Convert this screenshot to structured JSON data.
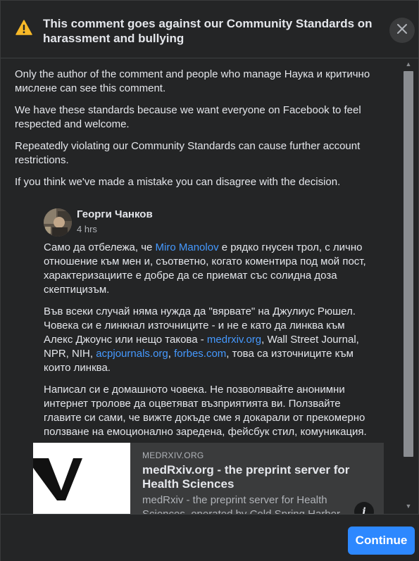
{
  "header": {
    "title": "This comment goes against our Community Standards on harassment and bullying",
    "warning_icon": "warning-triangle-icon",
    "close_icon": "close-icon"
  },
  "body": {
    "paragraphs": [
      "Only the author of the comment and people who manage Наука и критично мислене can see this comment.",
      "We have these standards because we want everyone on Facebook to feel respected and welcome.",
      "Repeatedly violating our Community Standards can cause further account restrictions.",
      "If you think we've made a mistake you can disagree with the decision."
    ]
  },
  "comment": {
    "author": "Георги Чанков",
    "time": "4 hrs",
    "p1_before": "Само да отбележа, че ",
    "p1_link": "Miro Manolov",
    "p1_after": " е рядко гнусен трол, с лично отношение към мен и, съответно, когато коментира под мой пост, характеризациите е добре да се приемат със солидна доза скептицизъм.",
    "p2_a": "Във всеки случай няма нужда да \"вярвате\" на Джулиус Рюшел. Човека си е линкнал източниците - и не е като да линква към Алекс Джоунс или нещо такова - ",
    "p2_link1": "medrxiv.org",
    "p2_b": ", Wall Street Journal, NPR, NIH, ",
    "p2_link2": "acpjournals.org",
    "p2_c": ", ",
    "p2_link3": "forbes.com",
    "p2_d": ", това са източниците към които линква.",
    "p3": "Написал си е домашното човека. Не позволявайте анонимни интернет тролове да оцветяват възприятията ви. Ползвайте главите си сами, че вижте докъде сме я докарали от прекомерно ползване на емоционално заредена, фейсбук стил, комуникация."
  },
  "link_preview": {
    "domain": "MEDRXIV.ORG",
    "title": "medRxiv.org - the preprint server for Health Sciences",
    "description": "medRxiv - the preprint server for Health Sciences, operated by Cold Spring Harbor Laboratory, a",
    "info_label": "i"
  },
  "footer": {
    "continue_label": "Continue"
  },
  "colors": {
    "background": "#242526",
    "text": "#e4e6eb",
    "link": "#4599ff",
    "primary_button": "#2d88ff",
    "warning": "#f7b928"
  }
}
